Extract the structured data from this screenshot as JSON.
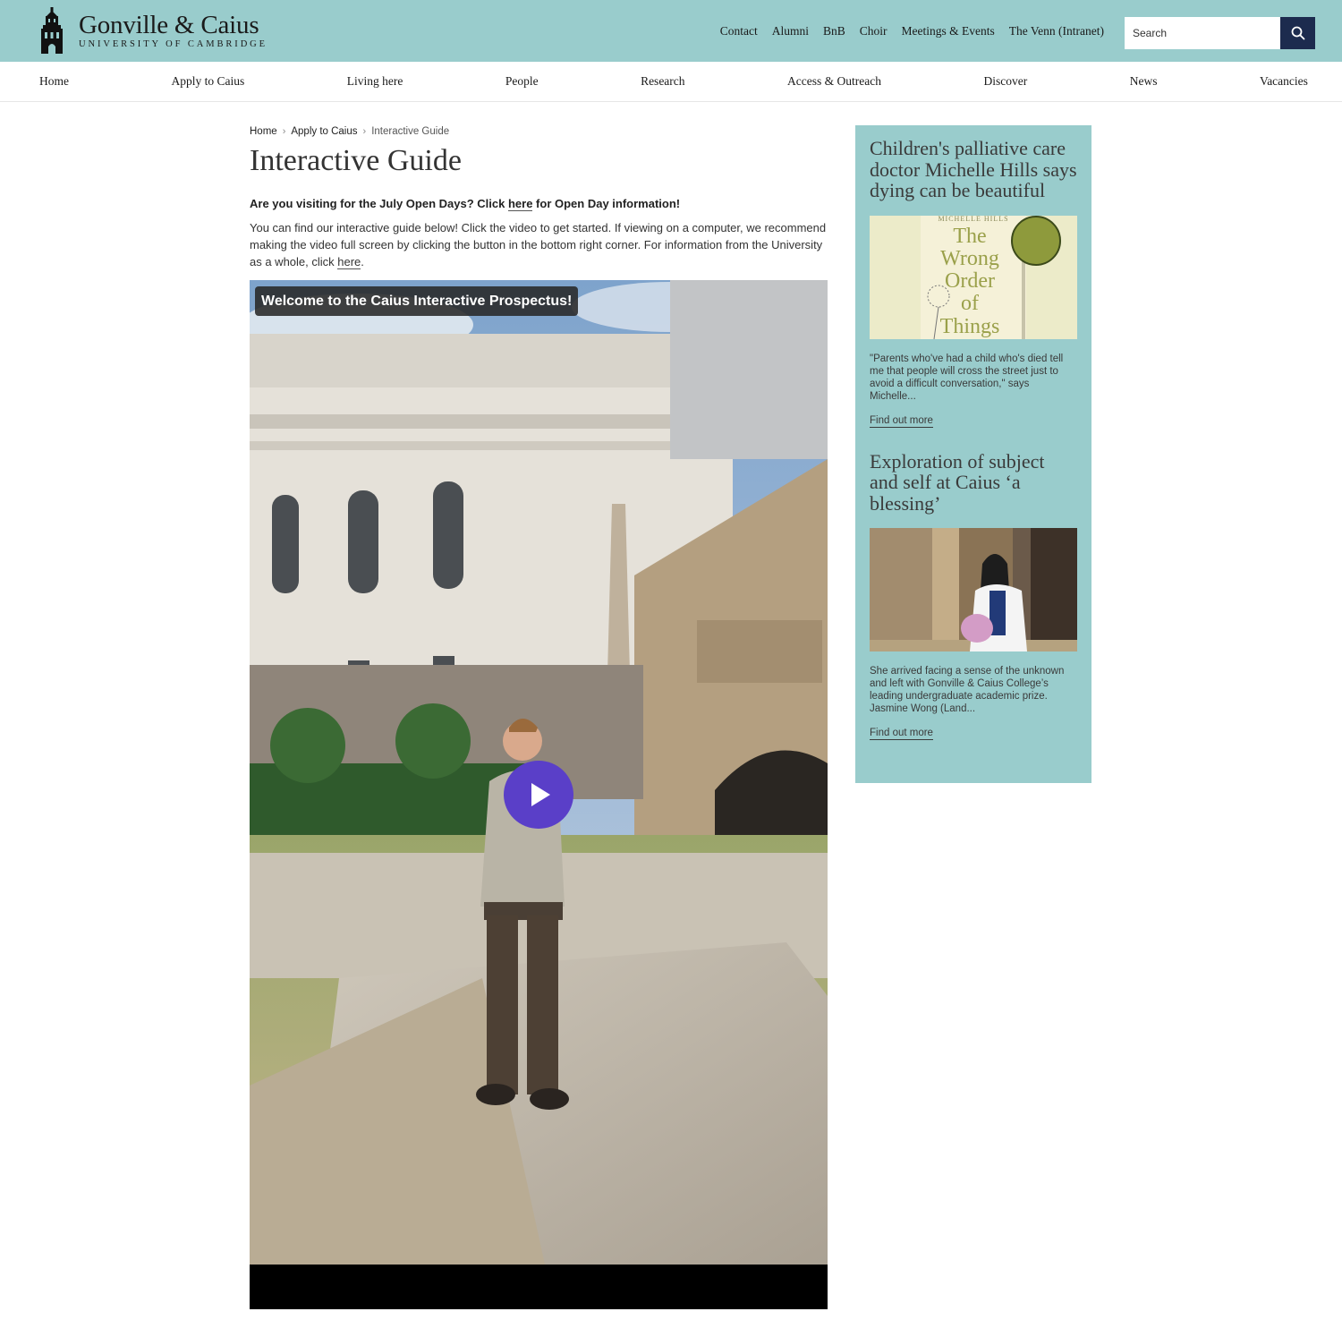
{
  "header": {
    "logo_name": "Gonville & Caius",
    "logo_sub": "UNIVERSITY OF CAMBRIDGE",
    "top_links": [
      "Contact",
      "Alumni",
      "BnB",
      "Choir",
      "Meetings & Events",
      "The Venn (Intranet)"
    ],
    "search_placeholder": "Search"
  },
  "nav": [
    "Home",
    "Apply to Caius",
    "Living here",
    "People",
    "Research",
    "Access & Outreach",
    "Discover",
    "News",
    "Vacancies"
  ],
  "breadcrumb": [
    "Home",
    "Apply to Caius",
    "Interactive Guide"
  ],
  "page": {
    "title": "Interactive Guide",
    "notice_pre": "Are you visiting for the July Open Days? Click ",
    "notice_link": "here",
    "notice_post": " for Open Day information!",
    "intro_pre": "You can find our interactive guide below! Click the video to get started. If viewing on a computer, we recommend making the video full screen by clicking the button in the bottom right corner. For information from the University as a whole, click ",
    "intro_link": "here",
    "intro_post": "."
  },
  "video": {
    "title": "Welcome to the Caius Interactive Prospectus!"
  },
  "sidebar": {
    "cards": [
      {
        "title": "Children's palliative care doctor Michelle Hills says dying can be beautiful",
        "image_text": "MICHELLE HILLS",
        "book_title": [
          "The",
          "Wrong",
          "Order",
          "of",
          "Things"
        ],
        "excerpt": "\"Parents who've had a child who's died tell me that people will cross the street just to avoid a difficult conversation,\" says Michelle...",
        "more": "Find out more"
      },
      {
        "title": "Exploration of subject and self at Caius ‘a blessing’",
        "excerpt": "She arrived facing a sense of the unknown and left with Gonville & Caius College’s leading undergraduate academic prize. Jasmine Wong (Land...",
        "more": "Find out more"
      }
    ]
  },
  "colors": {
    "header_bg": "#99cccc",
    "search_button": "#1c2b4e",
    "play_button": "#5a3fc8"
  }
}
